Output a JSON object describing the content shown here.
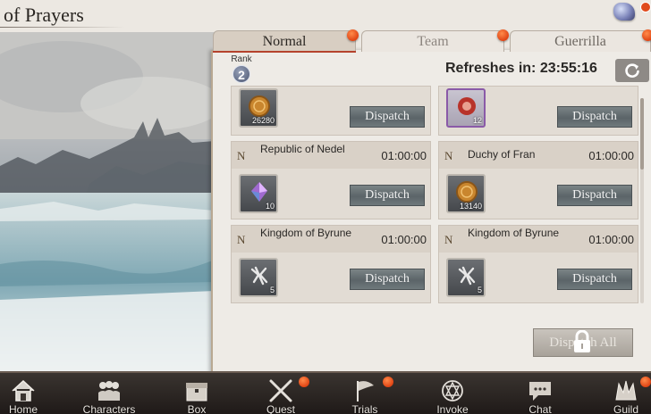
{
  "header": {
    "title": "of Prayers"
  },
  "tabs": [
    {
      "label": "Normal",
      "active": true
    },
    {
      "label": "Team",
      "active": false
    },
    {
      "label": "Guerrilla",
      "active": false
    }
  ],
  "rank": {
    "label": "Rank",
    "value": "2"
  },
  "refresh": {
    "text": "Refreshes in: 23:55:16"
  },
  "missions": [
    {
      "grade": "",
      "name": "",
      "time": "",
      "reward_icon": "coin-icon",
      "quantity": "26280",
      "dispatch_label": "Dispatch"
    },
    {
      "grade": "",
      "name": "",
      "time": "",
      "reward_icon": "rune-orb-icon",
      "quantity": "12",
      "dispatch_label": "Dispatch"
    },
    {
      "grade": "N",
      "name": "Republic of Nedel",
      "time": "01:00:00",
      "reward_icon": "crystal-icon",
      "quantity": "10",
      "dispatch_label": "Dispatch"
    },
    {
      "grade": "N",
      "name": "Duchy of Fran",
      "time": "01:00:00",
      "reward_icon": "coin-icon",
      "quantity": "13140",
      "dispatch_label": "Dispatch"
    },
    {
      "grade": "N",
      "name": "Kingdom of Byrune",
      "time": "01:00:00",
      "reward_icon": "material-icon",
      "quantity": "5",
      "dispatch_label": "Dispatch"
    },
    {
      "grade": "N",
      "name": "Kingdom of Byrune",
      "time": "01:00:00",
      "reward_icon": "material-icon",
      "quantity": "5",
      "dispatch_label": "Dispatch"
    }
  ],
  "dispatch_all": {
    "label": "Dispatch All",
    "locked": true
  },
  "nav": [
    {
      "label": "Home",
      "icon": "home-icon",
      "badge": false
    },
    {
      "label": "Characters",
      "icon": "characters-icon",
      "badge": false
    },
    {
      "label": "Box",
      "icon": "box-icon",
      "badge": false
    },
    {
      "label": "Quest",
      "icon": "quest-swords-icon",
      "badge": true
    },
    {
      "label": "Trials",
      "icon": "trials-flag-icon",
      "badge": true
    },
    {
      "label": "Invoke",
      "icon": "invoke-star-icon",
      "badge": false
    },
    {
      "label": "Chat",
      "icon": "chat-icon",
      "badge": false
    },
    {
      "label": "Guild",
      "icon": "guild-crown-icon",
      "badge": true
    }
  ],
  "colors": {
    "accent_dot": "#e04414",
    "tab_active_underline": "#b5422c",
    "nav_bg": "#1f1a18"
  }
}
